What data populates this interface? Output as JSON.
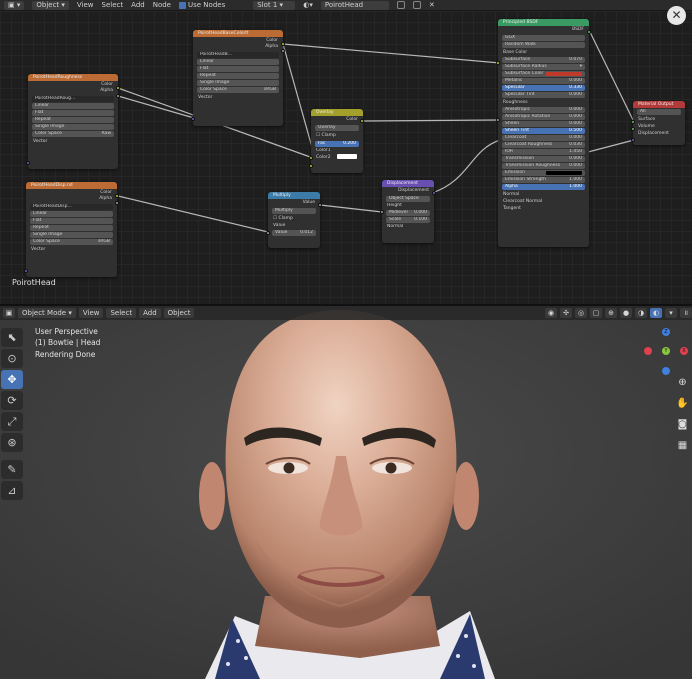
{
  "node_editor": {
    "header": {
      "mode": "Object",
      "menus": [
        "View",
        "Select",
        "Add",
        "Node"
      ],
      "use_nodes_label": "Use Nodes",
      "slot": "Slot 1",
      "material": "PoirotHead"
    },
    "label": "PoirotHead",
    "nodes": {
      "color_tex": {
        "title": "PoirotHeadBaseColorIt",
        "out1": "Color",
        "out2": "Alpha",
        "image": "PoirotHeadB...",
        "opts": [
          "Linear",
          "Flat",
          "Repeat",
          "Single Image"
        ],
        "cs_label": "Color Space",
        "cs_value": "sRGB",
        "vector": "Vector"
      },
      "rough_tex": {
        "title": "PoirotHeadRoughness",
        "out1": "Color",
        "out2": "Alpha",
        "image": "PoirotHeadRoug...",
        "opts": [
          "Linear",
          "Flat",
          "Repeat",
          "Single Image"
        ],
        "cs_label": "Color Space",
        "cs_value": "Raw",
        "vector": "Vector"
      },
      "disp_tex": {
        "title": "PoirotHeadDisp.nd",
        "out1": "Color",
        "out2": "Alpha",
        "image": "PoirotHeadDisp...",
        "opts": [
          "Linear",
          "Flat",
          "Repeat",
          "Single Image"
        ],
        "cs_label": "Color Space",
        "cs_value": "sRGB",
        "vector": "Vector"
      },
      "overlay": {
        "title": "Overlay",
        "out": "Color",
        "blend": "Overlay",
        "clamp": "Clamp",
        "fac_label": "Fac",
        "fac_value": "0.200",
        "in1": "Color1",
        "in2": "Color2"
      },
      "multiply": {
        "title": "Multiply",
        "out": "Value",
        "op": "Multiply",
        "clamp": "Clamp",
        "in1": "Value",
        "val_label": "Value",
        "val_value": "0.012"
      },
      "displacement": {
        "title": "Displacement",
        "out": "Displacement",
        "space": "Object Space",
        "height": "Height",
        "midlevel_label": "Midlevel",
        "midlevel_value": "0.000",
        "scale_label": "Scale",
        "scale_value": "0.100",
        "normal": "Normal"
      },
      "bsdf": {
        "title": "Principled BSDF",
        "out": "BSDF",
        "dist": "GGX",
        "sss_method": "Random Walk",
        "rows": [
          {
            "label": "Base Color",
            "value": "",
            "kind": "socket"
          },
          {
            "label": "Subsurface",
            "value": "0.070",
            "kind": "field"
          },
          {
            "label": "Subsurface Radius",
            "value": "",
            "kind": "dropdown"
          },
          {
            "label": "Subsurface Color",
            "value": "",
            "kind": "color"
          },
          {
            "label": "Metallic",
            "value": "0.000",
            "kind": "field"
          },
          {
            "label": "Specular",
            "value": "0.330",
            "kind": "blue"
          },
          {
            "label": "Specular Tint",
            "value": "0.000",
            "kind": "field"
          },
          {
            "label": "Roughness",
            "value": "",
            "kind": "socket"
          },
          {
            "label": "Anisotropic",
            "value": "0.000",
            "kind": "field"
          },
          {
            "label": "Anisotropic Rotation",
            "value": "0.000",
            "kind": "field"
          },
          {
            "label": "Sheen",
            "value": "0.000",
            "kind": "field"
          },
          {
            "label": "Sheen Tint",
            "value": "0.500",
            "kind": "blue"
          },
          {
            "label": "Clearcoat",
            "value": "0.000",
            "kind": "field"
          },
          {
            "label": "Clearcoat Roughness",
            "value": "0.030",
            "kind": "field"
          },
          {
            "label": "IOR",
            "value": "1.450",
            "kind": "field"
          },
          {
            "label": "Transmission",
            "value": "0.000",
            "kind": "field"
          },
          {
            "label": "Transmission Roughness",
            "value": "0.000",
            "kind": "field"
          },
          {
            "label": "Emission",
            "value": "",
            "kind": "black"
          },
          {
            "label": "Emission Strength",
            "value": "1.000",
            "kind": "field"
          },
          {
            "label": "Alpha",
            "value": "1.000",
            "kind": "blue"
          },
          {
            "label": "Normal",
            "value": "",
            "kind": "socket"
          },
          {
            "label": "Clearcoat Normal",
            "value": "",
            "kind": "socket"
          },
          {
            "label": "Tangent",
            "value": "",
            "kind": "socket"
          }
        ]
      },
      "output": {
        "title": "Material Output",
        "target": "All",
        "in1": "Surface",
        "in2": "Volume",
        "in3": "Displacement"
      }
    }
  },
  "viewport": {
    "header": {
      "mode": "Object Mode",
      "menus": [
        "View",
        "Select",
        "Add",
        "Object"
      ]
    },
    "info": {
      "line1": "User Perspective",
      "line2": "(1) Bowtie | Head",
      "line3": "Rendering Done"
    },
    "gizmo": {
      "z": "Z",
      "y": "Y",
      "x": "X"
    },
    "colors": {
      "accent": "#4772b3",
      "x_axis": "#e0414f",
      "y_axis": "#8bc63f",
      "z_axis": "#3f7fe0"
    }
  }
}
